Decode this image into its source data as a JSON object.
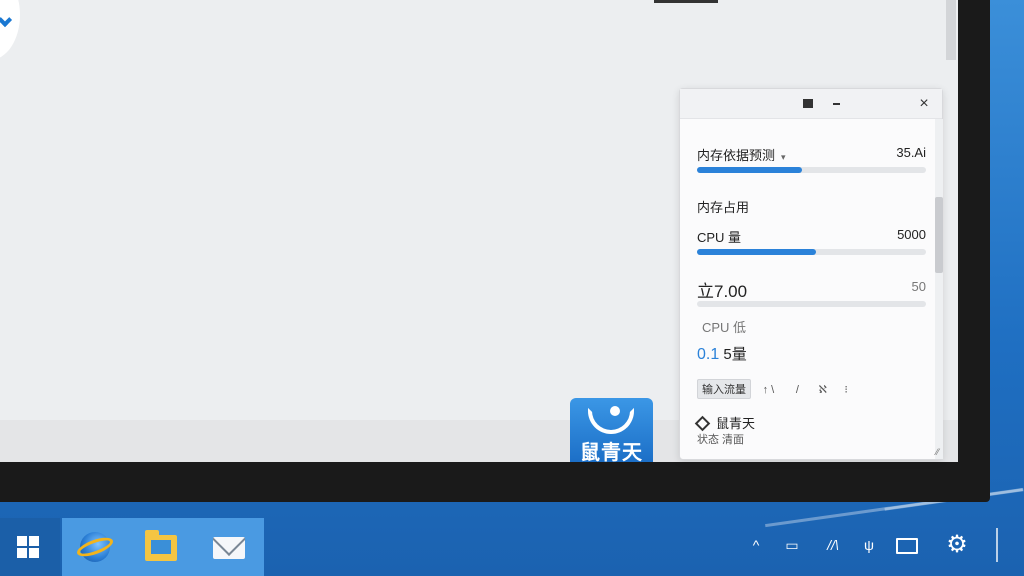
{
  "panel": {
    "memory_limit_label": "内存依据预测",
    "memory_limit_caret": "▾",
    "memory_limit_value": "35.Ai",
    "memory_limit_fill": 0.46,
    "memory_usage_label": "内存占用",
    "cpu_label": "CPU 量",
    "cpu_value": "5000",
    "cpu_fill": 0.52,
    "stat_value": "立7.00",
    "stat_right": "50",
    "cpu_sub_label": "CPU 低",
    "cpu_reading_prefix": "0.1",
    "cpu_reading_suffix": "5量",
    "chip_label": "输入流量",
    "chip_extra_1": "↑ \\",
    "chip_extra_2": "/",
    "chip_extra_3": "ℵ",
    "chip_extra_4": "⁝",
    "app_name": "鼠青天",
    "app_sub": "状态 清面"
  },
  "app_tile": {
    "text": "鼠青天"
  },
  "titlebar": {
    "close_glyph": "×"
  },
  "tray": {
    "chevron": "^",
    "battery": "▭",
    "network": "//\\",
    "wifi": "ψ",
    "settings": "⚙"
  },
  "colors": {
    "accent": "#2b82d9",
    "taskbar": "#1f6fc2"
  }
}
